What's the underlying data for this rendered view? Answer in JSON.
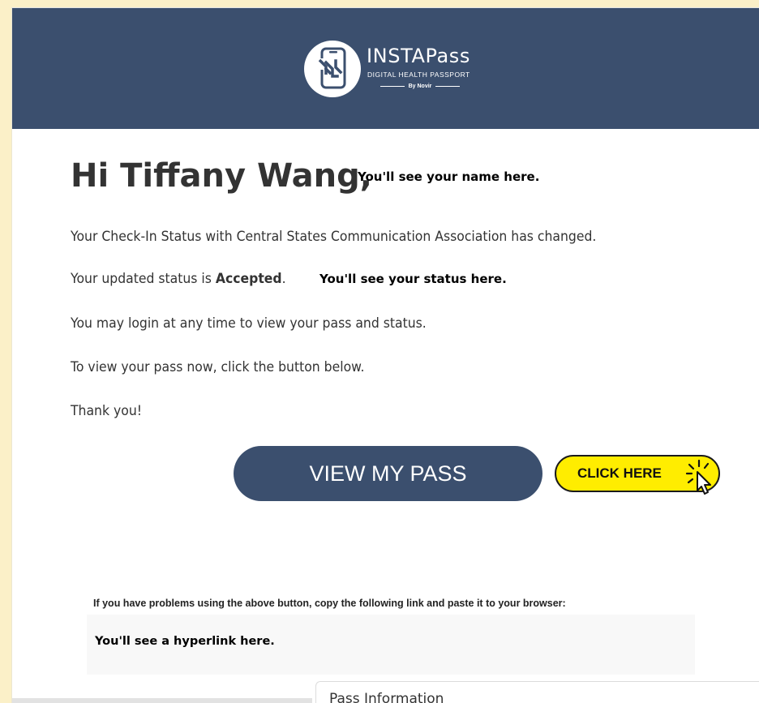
{
  "header": {
    "brand_name": "INSTAPass",
    "brand_tagline": "DIGITAL HEALTH PASSPORT",
    "brand_by": "By Novir",
    "bg_color": "#3b4f6e"
  },
  "email": {
    "greeting": "Hi Tiffany Wang,",
    "name_note": "You'll see your name here.",
    "line1": "Your Check-In Status with Central States Communication Association has changed.",
    "line2_prefix": "Your updated status is ",
    "status_value": "Accepted",
    "line2_suffix": ".",
    "status_note": "You'll see your status here.",
    "line3": "You may login at any time to view your pass and status.",
    "line4": "To view your pass now, click the button below.",
    "line5": "Thank you!"
  },
  "actions": {
    "view_pass_label": "VIEW MY PASS",
    "click_here_label": "CLICK HERE",
    "click_here_color": "#ffed00"
  },
  "footer": {
    "help_text": "If you have problems using the above button, copy the following link and paste it to your browser:",
    "link_placeholder": "You'll see a hyperlink here."
  },
  "overlay_panel": {
    "title": "Pass Information"
  },
  "icons": {
    "logo": "phone-scan-icon",
    "cursor": "cursor-click-icon"
  }
}
